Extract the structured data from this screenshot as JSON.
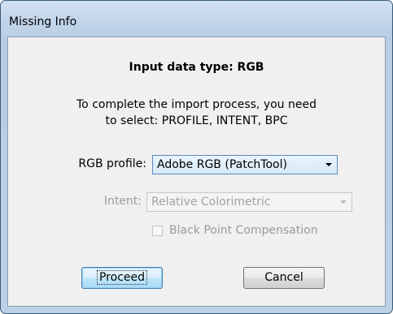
{
  "window": {
    "title": "Missing Info"
  },
  "dialog": {
    "heading": "Input data type: RGB",
    "message_line1": "To complete the import process, you need",
    "message_line2": "to select: PROFILE, INTENT, BPC",
    "rgb_profile": {
      "label": "RGB profile:",
      "value": "Adobe RGB (PatchTool)"
    },
    "intent": {
      "label": "Intent:",
      "value": "Relative Colorimetric",
      "enabled": false
    },
    "bpc": {
      "label": "Black Point Compensation",
      "checked": false,
      "enabled": false
    },
    "buttons": {
      "proceed": "Proceed",
      "cancel": "Cancel"
    }
  },
  "colors": {
    "titlebar": "#c3d6ea",
    "client_bg": "#f0f0f0",
    "default_button": "#bee6fd",
    "disabled_text": "#9a9a9a"
  }
}
